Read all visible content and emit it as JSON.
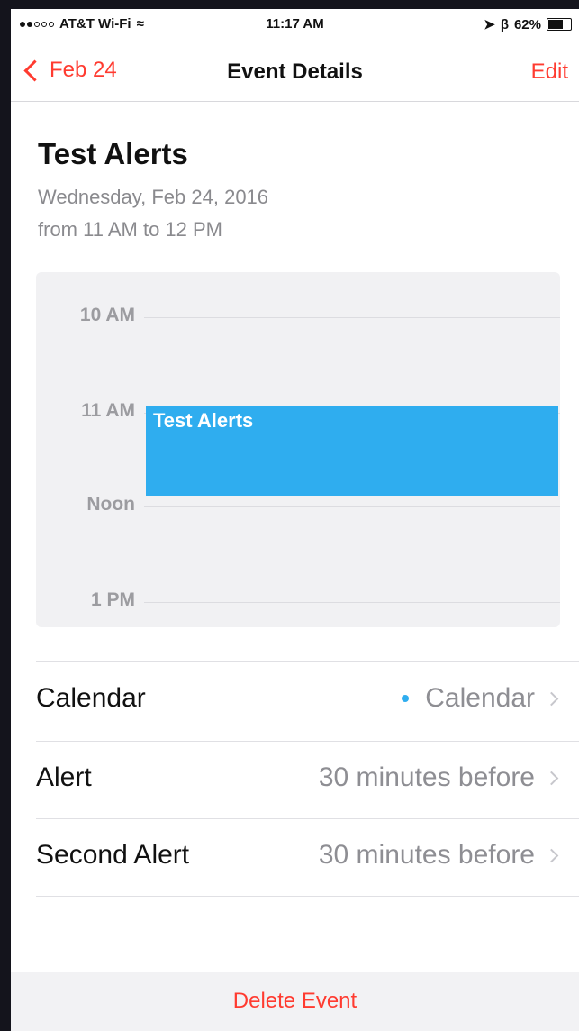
{
  "status_bar": {
    "carrier": "AT&T Wi-Fi",
    "time": "11:17 AM",
    "battery": "62%"
  },
  "nav": {
    "back_label": "Feb 24",
    "title": "Event Details",
    "edit_label": "Edit"
  },
  "event": {
    "title": "Test Alerts",
    "date": "Wednesday, Feb 24, 2016",
    "range": "from 11 AM to 12 PM"
  },
  "day_preview": {
    "hours": [
      "10 AM",
      "11 AM",
      "Noon",
      "1 PM"
    ],
    "block_label": "Test Alerts",
    "block_color": "#2fadef"
  },
  "details": [
    {
      "label": "Calendar",
      "value": "Calendar",
      "dot_color": "#2fadef"
    },
    {
      "label": "Alert",
      "value": "30 minutes before"
    },
    {
      "label": "Second Alert",
      "value": "30 minutes before"
    }
  ],
  "delete_label": "Delete Event",
  "accent": "#ff3b30"
}
